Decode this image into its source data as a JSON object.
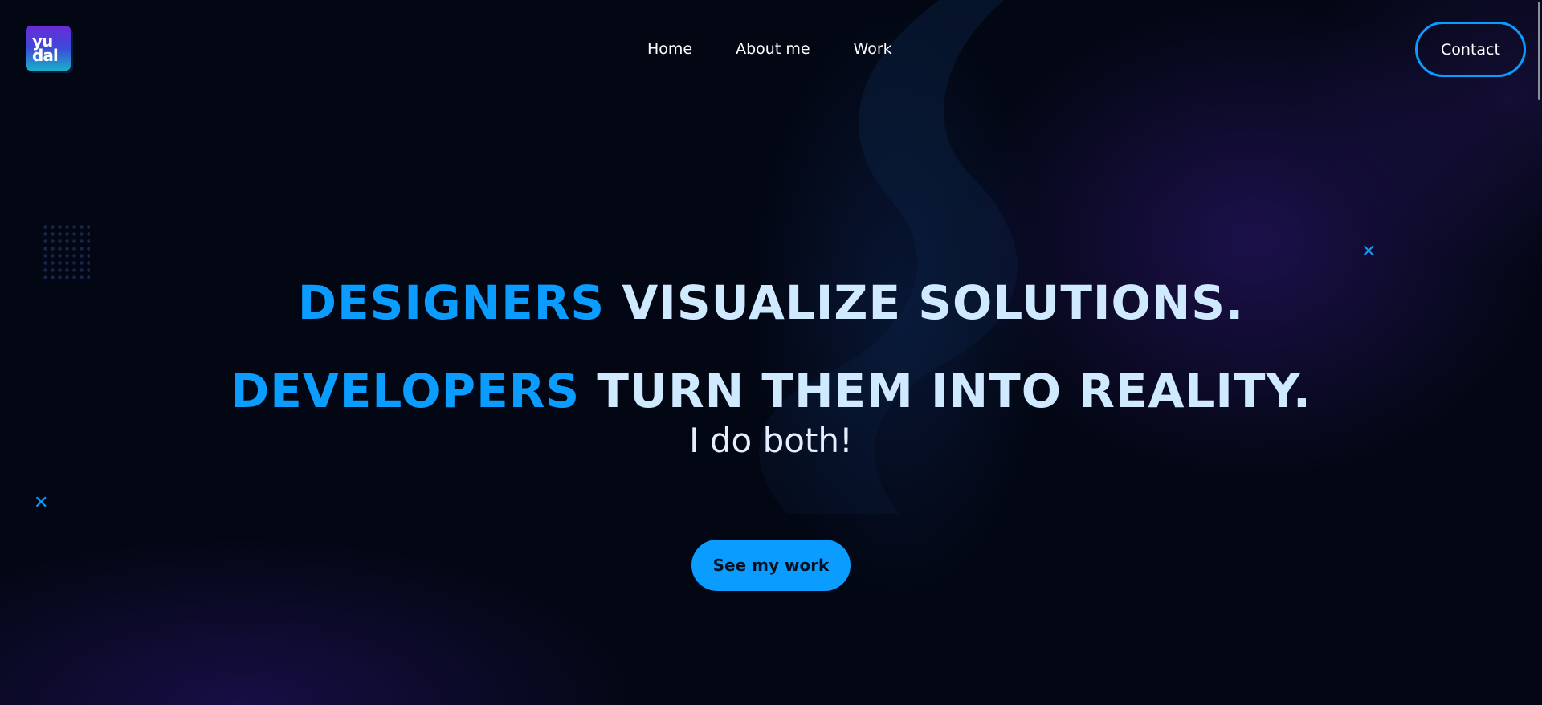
{
  "header": {
    "logo_text_top": "yu",
    "logo_text_bottom": "dal",
    "nav": [
      {
        "label": "Home"
      },
      {
        "label": "About me"
      },
      {
        "label": "Work"
      }
    ],
    "contact_label": "Contact"
  },
  "hero": {
    "line1_accent": "DESIGNERS",
    "line1_rest": "VISUALIZE SOLUTIONS.",
    "line2_accent": "DEVELOPERS",
    "line2_rest": "TURN THEM INTO REALITY.",
    "subtitle": "I do both!",
    "cta_label": "See my work"
  },
  "decor": {
    "x_icon_glyph": "✕"
  },
  "colors": {
    "accent": "#0a9cff",
    "background": "#030714",
    "headline_light": "#cfe9ff"
  }
}
